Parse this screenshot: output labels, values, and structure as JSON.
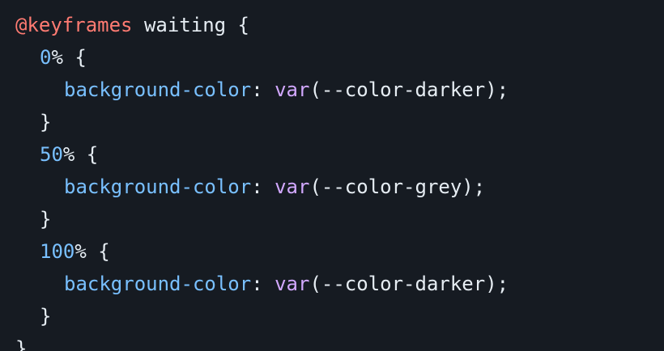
{
  "editor": {
    "background": "#161b22",
    "colors": {
      "at_rule": "#ff7b72",
      "plain": "#e6edf3",
      "number": "#79c0ff",
      "property": "#79c0ff",
      "function": "#d2a8ff"
    },
    "lines": [
      {
        "indent": 0,
        "tokens": [
          {
            "text": "@keyframes",
            "type": "at_rule"
          },
          {
            "text": " waiting {",
            "type": "plain"
          }
        ]
      },
      {
        "indent": 1,
        "tokens": [
          {
            "text": "0",
            "type": "number"
          },
          {
            "text": "% {",
            "type": "plain"
          }
        ]
      },
      {
        "indent": 2,
        "tokens": [
          {
            "text": "background-color",
            "type": "property"
          },
          {
            "text": ": ",
            "type": "plain"
          },
          {
            "text": "var",
            "type": "function"
          },
          {
            "text": "(--color-darker);",
            "type": "plain"
          }
        ]
      },
      {
        "indent": 1,
        "tokens": [
          {
            "text": "}",
            "type": "plain"
          }
        ]
      },
      {
        "indent": 1,
        "tokens": [
          {
            "text": "50",
            "type": "number"
          },
          {
            "text": "% {",
            "type": "plain"
          }
        ]
      },
      {
        "indent": 2,
        "tokens": [
          {
            "text": "background-color",
            "type": "property"
          },
          {
            "text": ": ",
            "type": "plain"
          },
          {
            "text": "var",
            "type": "function"
          },
          {
            "text": "(--color-grey);",
            "type": "plain"
          }
        ]
      },
      {
        "indent": 1,
        "tokens": [
          {
            "text": "}",
            "type": "plain"
          }
        ]
      },
      {
        "indent": 1,
        "tokens": [
          {
            "text": "100",
            "type": "number"
          },
          {
            "text": "% {",
            "type": "plain"
          }
        ]
      },
      {
        "indent": 2,
        "tokens": [
          {
            "text": "background-color",
            "type": "property"
          },
          {
            "text": ": ",
            "type": "plain"
          },
          {
            "text": "var",
            "type": "function"
          },
          {
            "text": "(--color-darker);",
            "type": "plain"
          }
        ]
      },
      {
        "indent": 1,
        "tokens": [
          {
            "text": "}",
            "type": "plain"
          }
        ]
      },
      {
        "indent": 0,
        "tokens": [
          {
            "text": "}",
            "type": "plain"
          }
        ]
      }
    ]
  }
}
